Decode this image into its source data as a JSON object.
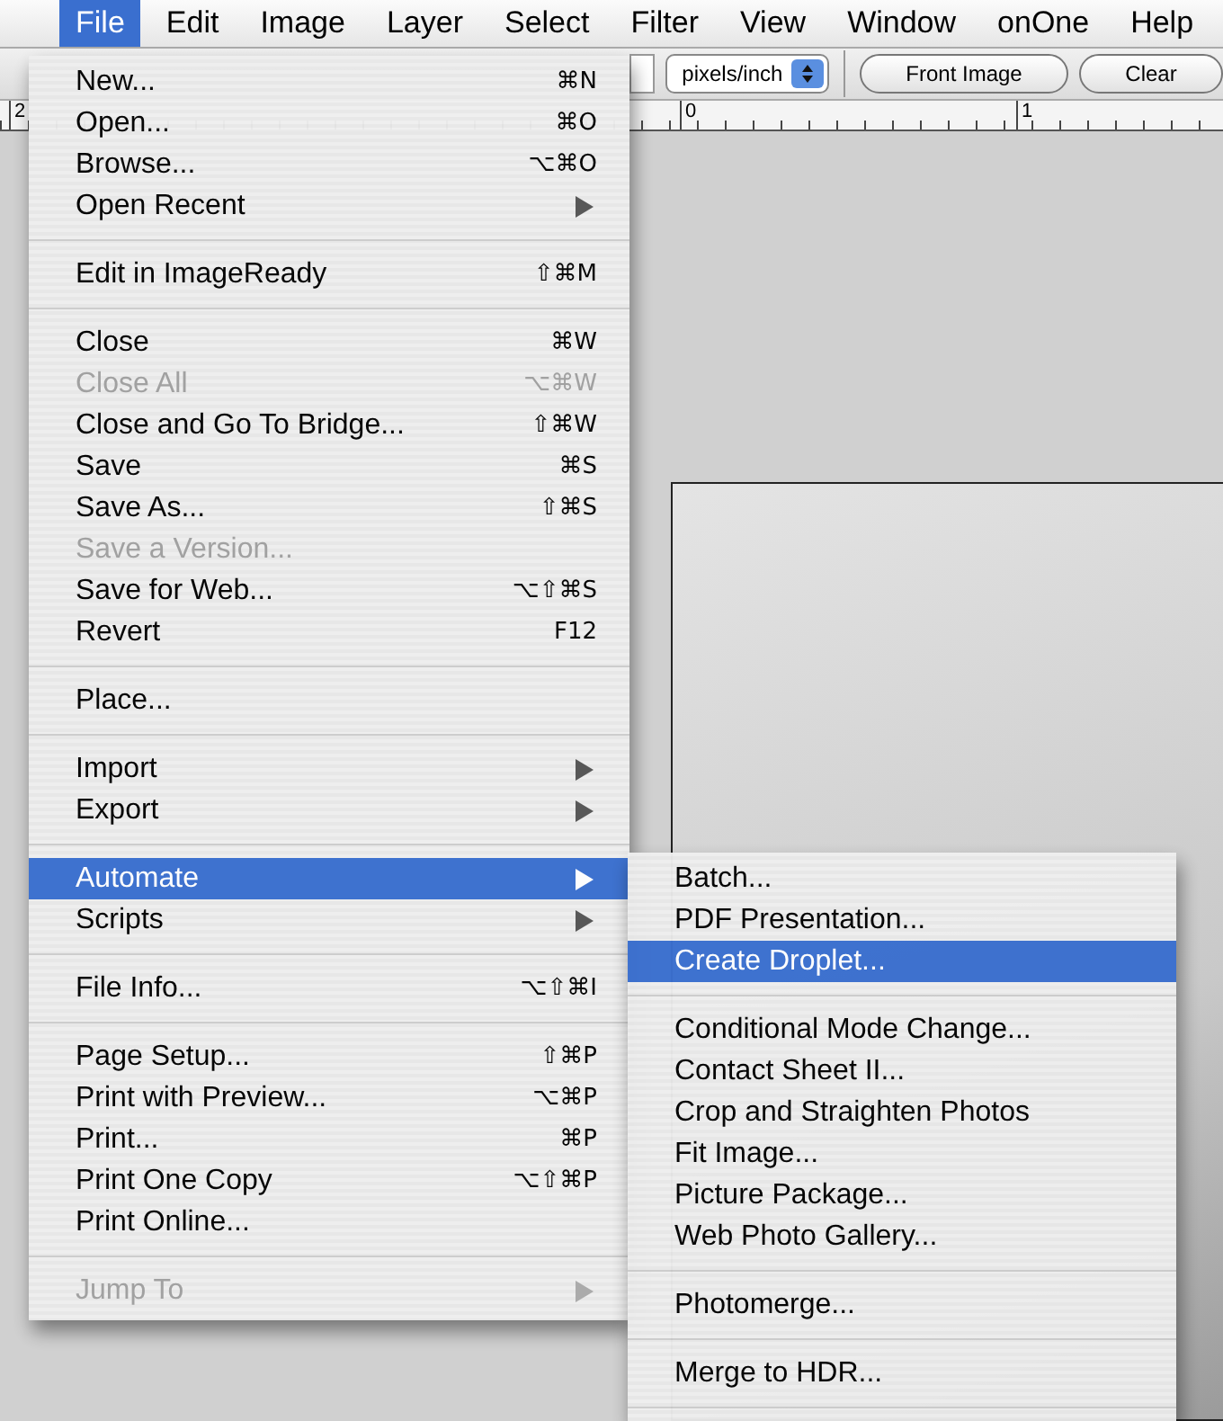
{
  "menubar": [
    {
      "label": "File",
      "selected": true
    },
    {
      "label": "Edit",
      "selected": false
    },
    {
      "label": "Image",
      "selected": false
    },
    {
      "label": "Layer",
      "selected": false
    },
    {
      "label": "Select",
      "selected": false
    },
    {
      "label": "Filter",
      "selected": false
    },
    {
      "label": "View",
      "selected": false
    },
    {
      "label": "Window",
      "selected": false
    },
    {
      "label": "onOne",
      "selected": false
    },
    {
      "label": "Help",
      "selected": false
    }
  ],
  "options_bar": {
    "unit_select": "pixels/inch",
    "buttons": [
      "Front Image",
      "Clear"
    ]
  },
  "ruler": {
    "labels": [
      "2",
      "0",
      "1"
    ]
  },
  "file_menu": {
    "items": [
      {
        "kind": "item",
        "label": "New...",
        "shortcut": "⌘N",
        "has_submenu": false,
        "disabled": false,
        "selected": false
      },
      {
        "kind": "item",
        "label": "Open...",
        "shortcut": "⌘O",
        "has_submenu": false,
        "disabled": false,
        "selected": false
      },
      {
        "kind": "item",
        "label": "Browse...",
        "shortcut": "⌥⌘O",
        "has_submenu": false,
        "disabled": false,
        "selected": false
      },
      {
        "kind": "item",
        "label": "Open Recent",
        "has_submenu": true,
        "disabled": false,
        "selected": false
      },
      {
        "kind": "separator"
      },
      {
        "kind": "item",
        "label": "Edit in ImageReady",
        "shortcut": "⇧⌘M",
        "has_submenu": false,
        "disabled": false,
        "selected": false
      },
      {
        "kind": "separator"
      },
      {
        "kind": "item",
        "label": "Close",
        "shortcut": "⌘W",
        "has_submenu": false,
        "disabled": false,
        "selected": false
      },
      {
        "kind": "item",
        "label": "Close All",
        "shortcut": "⌥⌘W",
        "has_submenu": false,
        "disabled": true,
        "selected": false
      },
      {
        "kind": "item",
        "label": "Close and Go To Bridge...",
        "shortcut": "⇧⌘W",
        "has_submenu": false,
        "disabled": false,
        "selected": false
      },
      {
        "kind": "item",
        "label": "Save",
        "shortcut": "⌘S",
        "has_submenu": false,
        "disabled": false,
        "selected": false
      },
      {
        "kind": "item",
        "label": "Save As...",
        "shortcut": "⇧⌘S",
        "has_submenu": false,
        "disabled": false,
        "selected": false
      },
      {
        "kind": "item",
        "label": "Save a Version...",
        "has_submenu": false,
        "disabled": true,
        "selected": false
      },
      {
        "kind": "item",
        "label": "Save for Web...",
        "shortcut": "⌥⇧⌘S",
        "has_submenu": false,
        "disabled": false,
        "selected": false
      },
      {
        "kind": "item",
        "label": "Revert",
        "shortcut": "F12",
        "has_submenu": false,
        "disabled": false,
        "selected": false
      },
      {
        "kind": "separator"
      },
      {
        "kind": "item",
        "label": "Place...",
        "has_submenu": false,
        "disabled": false,
        "selected": false
      },
      {
        "kind": "separator"
      },
      {
        "kind": "item",
        "label": "Import",
        "has_submenu": true,
        "disabled": false,
        "selected": false
      },
      {
        "kind": "item",
        "label": "Export",
        "has_submenu": true,
        "disabled": false,
        "selected": false
      },
      {
        "kind": "separator"
      },
      {
        "kind": "item",
        "label": "Automate",
        "has_submenu": true,
        "disabled": false,
        "selected": true
      },
      {
        "kind": "item",
        "label": "Scripts",
        "has_submenu": true,
        "disabled": false,
        "selected": false
      },
      {
        "kind": "separator"
      },
      {
        "kind": "item",
        "label": "File Info...",
        "shortcut": "⌥⇧⌘I",
        "has_submenu": false,
        "disabled": false,
        "selected": false
      },
      {
        "kind": "separator"
      },
      {
        "kind": "item",
        "label": "Page Setup...",
        "shortcut": "⇧⌘P",
        "has_submenu": false,
        "disabled": false,
        "selected": false
      },
      {
        "kind": "item",
        "label": "Print with Preview...",
        "shortcut": "⌥⌘P",
        "has_submenu": false,
        "disabled": false,
        "selected": false
      },
      {
        "kind": "item",
        "label": "Print...",
        "shortcut": "⌘P",
        "has_submenu": false,
        "disabled": false,
        "selected": false
      },
      {
        "kind": "item",
        "label": "Print One Copy",
        "shortcut": "⌥⇧⌘P",
        "has_submenu": false,
        "disabled": false,
        "selected": false
      },
      {
        "kind": "item",
        "label": "Print Online...",
        "has_submenu": false,
        "disabled": false,
        "selected": false
      },
      {
        "kind": "separator"
      },
      {
        "kind": "item",
        "label": "Jump To",
        "has_submenu": true,
        "disabled": true,
        "selected": false
      }
    ]
  },
  "automate_submenu": {
    "items": [
      {
        "kind": "item",
        "label": "Batch...",
        "selected": false
      },
      {
        "kind": "item",
        "label": "PDF Presentation...",
        "selected": false
      },
      {
        "kind": "item",
        "label": "Create Droplet...",
        "selected": true
      },
      {
        "kind": "separator"
      },
      {
        "kind": "item",
        "label": "Conditional Mode Change...",
        "selected": false
      },
      {
        "kind": "item",
        "label": "Contact Sheet II...",
        "selected": false
      },
      {
        "kind": "item",
        "label": "Crop and Straighten Photos",
        "selected": false
      },
      {
        "kind": "item",
        "label": "Fit Image...",
        "selected": false
      },
      {
        "kind": "item",
        "label": "Picture Package...",
        "selected": false
      },
      {
        "kind": "item",
        "label": "Web Photo Gallery...",
        "selected": false
      },
      {
        "kind": "separator"
      },
      {
        "kind": "item",
        "label": "Photomerge...",
        "selected": false
      },
      {
        "kind": "separator"
      },
      {
        "kind": "item",
        "label": "Merge to HDR...",
        "selected": false
      },
      {
        "kind": "separator"
      }
    ]
  }
}
